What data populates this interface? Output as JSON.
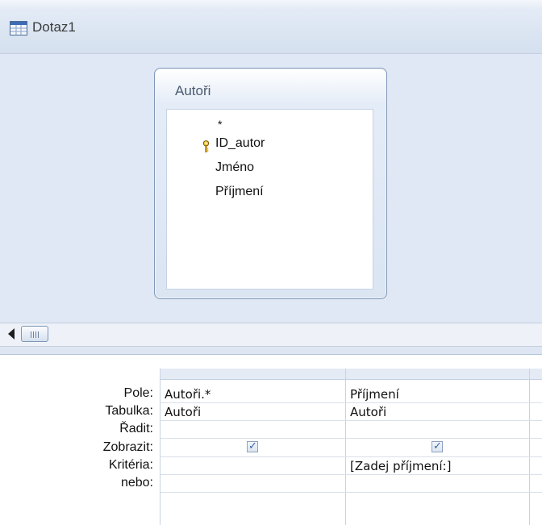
{
  "window": {
    "title": "Dotaz1",
    "icon": "query-icon"
  },
  "field_list": {
    "title": "Autoři",
    "fields": [
      {
        "name": "*"
      },
      {
        "name": "ID_autor",
        "primary_key": true,
        "icon": "key-icon"
      },
      {
        "name": "Jméno"
      },
      {
        "name": "Příjmení"
      }
    ]
  },
  "scrollbar": {
    "left_arrow_icon": "arrow-left-icon",
    "thumb_icon": "scroll-thumb-icon"
  },
  "grid": {
    "row_labels": {
      "field": "Pole:",
      "table": "Tabulka:",
      "sort": "Řadit:",
      "show": "Zobrazit:",
      "criteria": "Kritéria:",
      "or": "nebo:"
    },
    "columns": [
      {
        "field": "Autoři.*",
        "table": "Autoři",
        "sort": "",
        "show": true,
        "criteria": "",
        "or": ""
      },
      {
        "field": "Příjmení",
        "table": "Autoři",
        "sort": "",
        "show": true,
        "criteria": "[Zadej příjmení:]",
        "or": ""
      }
    ]
  },
  "colors": {
    "accent": "#3a64a6",
    "design_background": "#dfe8f4"
  }
}
